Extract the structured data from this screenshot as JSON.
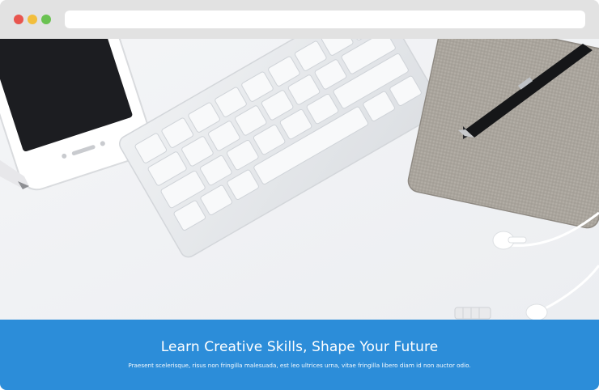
{
  "window": {
    "controls": [
      {
        "name": "close",
        "color": "#e8554e"
      },
      {
        "name": "minimize",
        "color": "#f2be3c"
      },
      {
        "name": "maximize",
        "color": "#6ac251"
      }
    ],
    "address_bar_value": ""
  },
  "hero": {
    "image_subject": "desk flatlay with smartphone, keyboard, notebook, pen and earphones"
  },
  "banner": {
    "title": "Learn Creative Skills, Shape Your Future",
    "subtitle": "Praesent scelerisque, risus non fringilla malesuada, est leo ultrices urna, vitae fringilla libero diam id non auctor odio.",
    "background_color": "#2c8dd9"
  }
}
